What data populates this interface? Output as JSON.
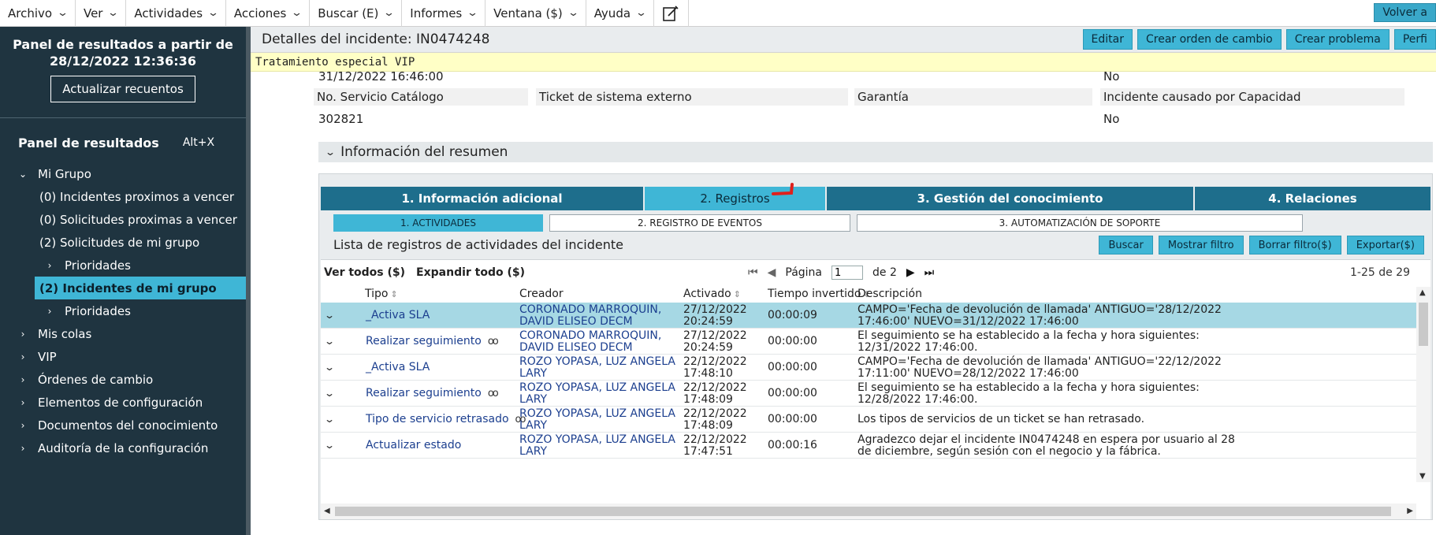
{
  "menubar": {
    "items": [
      {
        "label": "Archivo"
      },
      {
        "label": "Ver"
      },
      {
        "label": "Actividades"
      },
      {
        "label": "Acciones"
      },
      {
        "label": "Buscar (E)"
      },
      {
        "label": "Informes"
      },
      {
        "label": "Ventana ($)"
      },
      {
        "label": "Ayuda"
      }
    ],
    "back_button": "Volver a"
  },
  "sidebar": {
    "results_title_line1": "Panel de resultados a partir de",
    "results_title_line2": "28/12/2022 12:36:36",
    "update_button": "Actualizar recuentos",
    "panel_label": "Panel de resultados",
    "panel_shortcut": "Alt+X",
    "tree": {
      "mi_grupo": "Mi Grupo",
      "incidentes_vencer": "(0) Incidentes proximos a vencer",
      "solicitudes_vencer": "(0) Solicitudes proximas a vencer",
      "solicitudes_grupo": "(2) Solicitudes de mi grupo",
      "prioridades_1": "Prioridades",
      "incidentes_grupo": "(2) Incidentes de mi grupo",
      "prioridades_2": "Prioridades",
      "mis_colas": "Mis colas",
      "vip": "VIP",
      "ordenes": "Órdenes de cambio",
      "elementos": "Elementos de configuración",
      "documentos": "Documentos del conocimiento",
      "auditoria": "Auditoría de la configuración"
    }
  },
  "header": {
    "title": "Detalles del incidente: IN0474248",
    "actions": [
      "Editar",
      "Crear orden de cambio",
      "Crear problema",
      "Perfi"
    ],
    "vip_notice": "Tratamiento especial VIP"
  },
  "details": {
    "top_date": "31/12/2022 16:46:00",
    "top_value": "No",
    "labels": [
      "No. Servicio Catálogo",
      "Ticket de sistema externo",
      "Garantía",
      "Incidente causado por Capacidad"
    ],
    "catalog_value": "302821",
    "capacity_value": "No"
  },
  "summary": {
    "header": "Información del resumen",
    "tabs": [
      "1. Información adicional",
      "2. Registros",
      "3. Gestión del conocimiento",
      "4. Relaciones"
    ],
    "subtabs": [
      "1. ACTIVIDADES",
      "2. REGISTRO DE EVENTOS",
      "3. AUTOMATIZACIÓN DE SOPORTE"
    ],
    "list_title": "Lista de registros de actividades del incidente",
    "list_actions": [
      "Buscar",
      "Mostrar filtro",
      "Borrar filtro($)",
      "Exportar($)"
    ]
  },
  "grid": {
    "ver_todos": "Ver todos ($)",
    "expandir_todo": "Expandir todo ($)",
    "page_label": "Página",
    "page_value": "1",
    "page_of": "de 2",
    "range": "1-25 de 29",
    "columns": [
      "Tipo",
      "Creador",
      "Activado",
      "Tiempo invertido",
      "Descripción"
    ],
    "rows": [
      {
        "tipo": "_Activa SLA",
        "creador": "CORONADO MARROQUIN, DAVID ELISEO DECM",
        "fecha": "27/12/2022",
        "hora": "20:24:59",
        "tiempo": "00:00:09",
        "desc": "CAMPO='Fecha de devolución de llamada' ANTIGUO='28/12/2022 17:46:00' NUEVO=31/12/2022 17:46:00"
      },
      {
        "tipo": "Realizar seguimiento",
        "creador": "CORONADO MARROQUIN, DAVID ELISEO DECM",
        "fecha": "27/12/2022",
        "hora": "20:24:59",
        "tiempo": "00:00:00",
        "desc": "El seguimiento se ha establecido a la fecha y hora siguientes: 12/31/2022 17:46:00."
      },
      {
        "tipo": "_Activa SLA",
        "creador": "ROZO YOPASA, LUZ ANGELA LARY",
        "fecha": "22/12/2022",
        "hora": "17:48:10",
        "tiempo": "00:00:00",
        "desc": "CAMPO='Fecha de devolución de llamada' ANTIGUO='22/12/2022 17:11:00' NUEVO=28/12/2022 17:46:00"
      },
      {
        "tipo": "Realizar seguimiento",
        "creador": "ROZO YOPASA, LUZ ANGELA LARY",
        "fecha": "22/12/2022",
        "hora": "17:48:09",
        "tiempo": "00:00:00",
        "desc": "El seguimiento se ha establecido a la fecha y hora siguientes: 12/28/2022 17:46:00."
      },
      {
        "tipo": "Tipo de servicio retrasado",
        "creador": "ROZO YOPASA, LUZ ANGELA LARY",
        "fecha": "22/12/2022",
        "hora": "17:48:09",
        "tiempo": "00:00:00",
        "desc": "Los tipos de servicios de un ticket se han retrasado."
      },
      {
        "tipo": "Actualizar estado",
        "creador": "ROZO YOPASA, LUZ ANGELA LARY",
        "fecha": "22/12/2022",
        "hora": "17:47:51",
        "tiempo": "00:00:16",
        "desc": "Agradezco dejar el incidente IN0474248 en espera por usuario al 28 de diciembre, según sesión con el negocio y la fábrica."
      }
    ]
  },
  "colors": {
    "sidebar_bg": "#1f3440",
    "accent": "#3fb6d6",
    "tab_dark": "#1e6e8c",
    "link": "#1c3f8f",
    "vip_bg": "#ffffc6"
  }
}
